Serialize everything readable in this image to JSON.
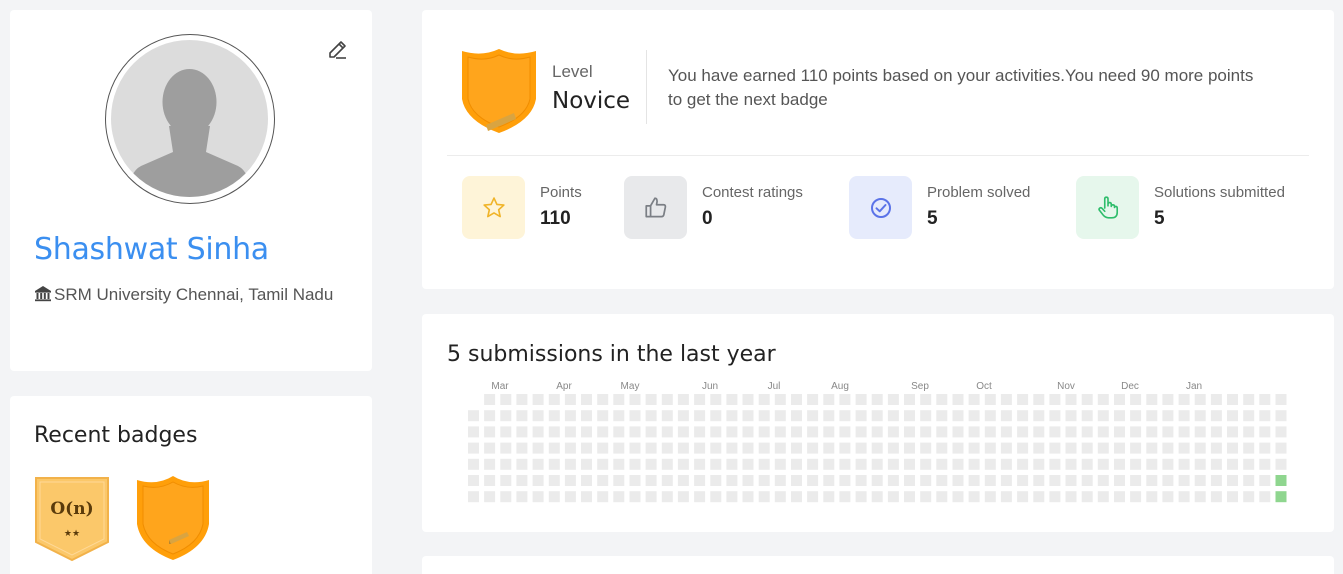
{
  "profile": {
    "name": "Shashwat Sinha",
    "institution": "SRM University Chennai, Tamil Nadu"
  },
  "badges": {
    "title": "Recent badges",
    "items": [
      {
        "label": "O(n)",
        "stars": "★★",
        "color": "#fbc86a"
      },
      {
        "label": "",
        "color": "#ff9f0a"
      }
    ]
  },
  "level": {
    "label": "Level",
    "value": "Novice",
    "message": "You have earned 110 points based on your activities.You need 90 more points to get the next badge"
  },
  "stats": [
    {
      "label": "Points",
      "value": "110",
      "icon": "star-icon",
      "bg": "#fef4d8",
      "fg": "#f0b429"
    },
    {
      "label": "Contest ratings",
      "value": "0",
      "icon": "thumbs-up-icon",
      "bg": "#e8e9eb",
      "fg": "#7b7f85"
    },
    {
      "label": "Problem solved",
      "value": "5",
      "icon": "check-circle-icon",
      "bg": "#e6ebfc",
      "fg": "#5b73e8"
    },
    {
      "label": "Solutions submitted",
      "value": "5",
      "icon": "pointer-hand-icon",
      "bg": "#e6f7ec",
      "fg": "#2ebd6b"
    }
  ],
  "submissions": {
    "title": "5 submissions in the last year",
    "months": [
      "Mar",
      "Apr",
      "May",
      "Jun",
      "Jul",
      "Aug",
      "Sep",
      "Oct",
      "Nov",
      "Dec",
      "Jan"
    ],
    "weeks": 51,
    "days": 7,
    "active_cells": [
      [
        50,
        5
      ],
      [
        50,
        6
      ]
    ],
    "empty_color": "#ebebeb",
    "active_color": "#8fd68f"
  }
}
